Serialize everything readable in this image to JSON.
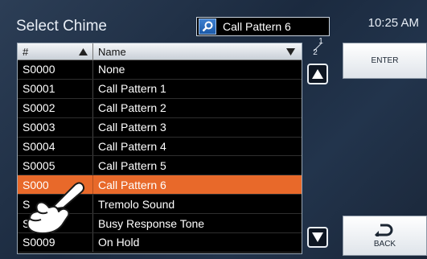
{
  "header": {
    "title": "Select Chime",
    "time": "10:25 AM"
  },
  "search": {
    "value": "Call Pattern 6",
    "icon": "search-icon"
  },
  "table": {
    "columns": [
      "#",
      "Name"
    ],
    "rows": [
      {
        "id": "S0000",
        "name": "None"
      },
      {
        "id": "S0001",
        "name": "Call Pattern 1"
      },
      {
        "id": "S0002",
        "name": "Call Pattern 2"
      },
      {
        "id": "S0003",
        "name": "Call Pattern 3"
      },
      {
        "id": "S0004",
        "name": "Call Pattern 4"
      },
      {
        "id": "S0005",
        "name": "Call Pattern 5"
      },
      {
        "id": "S000",
        "name": "Call Pattern 6",
        "selected": true
      },
      {
        "id": "S",
        "name": "Tremolo Sound"
      },
      {
        "id": "S",
        "name": "Busy Response Tone"
      },
      {
        "id": "S0009",
        "name": "On Hold"
      }
    ],
    "selected_color": "#e8692a"
  },
  "pager": {
    "current": "1",
    "total": "2"
  },
  "buttons": {
    "enter": "ENTER",
    "back": "BACK"
  }
}
